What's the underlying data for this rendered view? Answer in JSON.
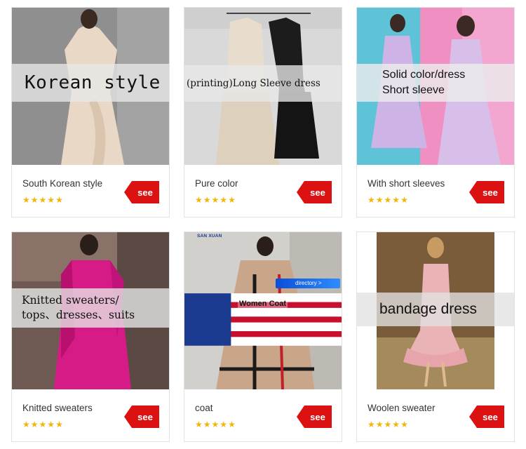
{
  "products": [
    {
      "overlay_lines": [
        "Korean style"
      ],
      "title": "South Korean style",
      "rating": 5,
      "see_label": "see"
    },
    {
      "overlay_lines": [
        "(printing)Long Sleeve dress"
      ],
      "title": "Pure color",
      "rating": 5,
      "see_label": "see"
    },
    {
      "overlay_lines": [
        "Solid color/dress",
        "Short sleeve"
      ],
      "title": "With short sleeves",
      "rating": 5,
      "see_label": "see"
    },
    {
      "overlay_lines": [
        "Knitted sweaters/",
        "tops、dresses、suits"
      ],
      "title": "Knitted sweaters",
      "rating": 5,
      "see_label": "see"
    },
    {
      "overlay_lines": [],
      "brand": "SAN XUAN",
      "directory_label": "directory >",
      "caption": "Women Coat",
      "title": "coat",
      "rating": 5,
      "see_label": "see"
    },
    {
      "overlay_lines": [
        "bandage dress"
      ],
      "title": "Woolen sweater",
      "rating": 5,
      "see_label": "see"
    }
  ],
  "colors": {
    "see_button": "#dc1212",
    "star": "#f2b705",
    "card_border": "#e2e2e2"
  },
  "star_glyph": "★"
}
